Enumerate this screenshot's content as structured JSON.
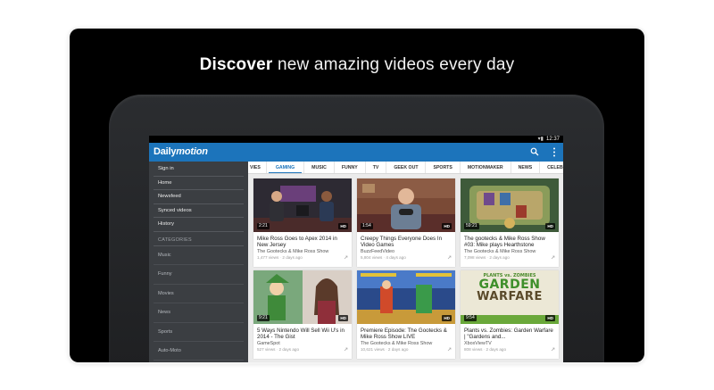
{
  "headline": {
    "bold": "Discover",
    "rest": " new amazing videos every day"
  },
  "statusbar": {
    "time": "12:37"
  },
  "appbar": {
    "logo_plain": "Daily",
    "logo_italic": "motion"
  },
  "sidebar": {
    "items": [
      {
        "label": "Sign in"
      },
      {
        "label": "Home"
      },
      {
        "label": "Newsfeed"
      },
      {
        "label": "Synced videos"
      },
      {
        "label": "History"
      }
    ],
    "categories_header": "CATEGORIES",
    "categories": [
      {
        "label": "Music"
      },
      {
        "label": "Funny"
      },
      {
        "label": "Movies"
      },
      {
        "label": "News"
      },
      {
        "label": "Sports"
      },
      {
        "label": "Auto-Moto"
      }
    ]
  },
  "tabs": [
    {
      "label": "VIES"
    },
    {
      "label": "GAMING"
    },
    {
      "label": "MUSIC"
    },
    {
      "label": "FUNNY"
    },
    {
      "label": "TV"
    },
    {
      "label": "GEEK OUT"
    },
    {
      "label": "SPORTS"
    },
    {
      "label": "MOTIONMAKER"
    },
    {
      "label": "NEWS"
    },
    {
      "label": "CELEB"
    }
  ],
  "active_tab": "GAMING",
  "videos": [
    {
      "duration": "2:21",
      "hd": "HD",
      "title": "Mike Ross Goes to Apex 2014 in New Jersey",
      "channel": "The Gootecks & Mike Ross Show",
      "views": "1,477 views",
      "age": "2 days ago"
    },
    {
      "duration": "1:54",
      "hd": "HD",
      "title": "Creepy Things Everyone Does In Video Games",
      "channel": "BuzzFeedVideo",
      "views": "5,804 views",
      "age": "4 days ago"
    },
    {
      "duration": "59:21",
      "hd": "HD",
      "title": "The gootecks & Mike Ross Show #03: Mike plays Hearthstone",
      "channel": "The Gootecks & Mike Ross Show",
      "views": "7,098 views",
      "age": "2 days ago"
    },
    {
      "duration": "9:21",
      "hd": "HD",
      "title": "5 Ways Nintendo Will Sell Wii U's in 2014 - The Gist",
      "channel": "GameSpot",
      "views": "527 views",
      "age": "2 days ago"
    },
    {
      "duration": "",
      "hd": "HD",
      "title": "Premiere Episode: The Gootecks & Mike Ross Show LIVE",
      "channel": "The Gootecks & Mike Ross Show",
      "views": "10,621 views",
      "age": "2 days ago"
    },
    {
      "duration": "9:54",
      "hd": "HD",
      "title": "Plants vs. Zombies: Garden Warfare | \"Gardens and...",
      "channel": "XboxViewTV",
      "views": "808 views",
      "age": "2 days ago"
    }
  ],
  "thumb_overlays": {
    "garden_line1": "PLANTS vs. ZOMBIES",
    "garden_line2": "GARDEN",
    "garden_line3": "WARFARE"
  },
  "colors": {
    "brand_blue": "#1c74bb",
    "sidebar_bg": "#3b3e42",
    "content_bg": "#ebebeb"
  }
}
